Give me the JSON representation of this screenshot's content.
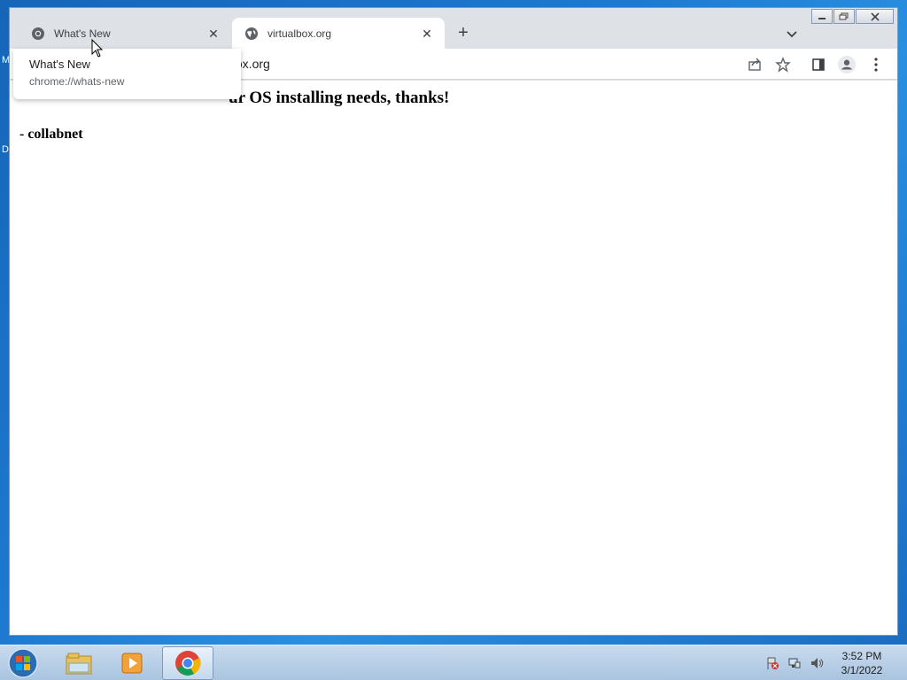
{
  "desktop": {
    "labels": [
      "M",
      "D"
    ]
  },
  "browser": {
    "tabs": [
      {
        "title": "What's New",
        "icon": "chrome-icon",
        "active": false
      },
      {
        "title": "virtualbox.org",
        "icon": "globe-icon",
        "active": true
      }
    ],
    "new_tab_symbol": "+",
    "close_symbol": "✕",
    "address_text": "lbox.org",
    "tooltip": {
      "title": "What's New",
      "url": "chrome://whats-new"
    }
  },
  "page": {
    "heading_visible": "ur OS installing needs, thanks!",
    "signature": "- collabnet"
  },
  "taskbar": {
    "apps": [
      {
        "name": "file-explorer-icon",
        "active": false
      },
      {
        "name": "media-player-icon",
        "active": false
      },
      {
        "name": "chrome-icon",
        "active": true
      }
    ],
    "time": "3:52 PM",
    "date": "3/1/2022"
  },
  "colors": {
    "tabstrip": "#dee1e6",
    "taskbar": "#b8cfe8",
    "desktop": "#1d7ad0"
  }
}
